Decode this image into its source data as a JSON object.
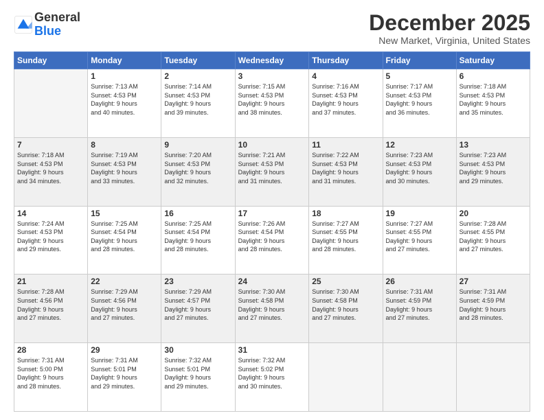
{
  "logo": {
    "general": "General",
    "blue": "Blue"
  },
  "title": "December 2025",
  "location": "New Market, Virginia, United States",
  "days_of_week": [
    "Sunday",
    "Monday",
    "Tuesday",
    "Wednesday",
    "Thursday",
    "Friday",
    "Saturday"
  ],
  "weeks": [
    [
      {
        "day": "",
        "info": ""
      },
      {
        "day": "1",
        "info": "Sunrise: 7:13 AM\nSunset: 4:53 PM\nDaylight: 9 hours\nand 40 minutes."
      },
      {
        "day": "2",
        "info": "Sunrise: 7:14 AM\nSunset: 4:53 PM\nDaylight: 9 hours\nand 39 minutes."
      },
      {
        "day": "3",
        "info": "Sunrise: 7:15 AM\nSunset: 4:53 PM\nDaylight: 9 hours\nand 38 minutes."
      },
      {
        "day": "4",
        "info": "Sunrise: 7:16 AM\nSunset: 4:53 PM\nDaylight: 9 hours\nand 37 minutes."
      },
      {
        "day": "5",
        "info": "Sunrise: 7:17 AM\nSunset: 4:53 PM\nDaylight: 9 hours\nand 36 minutes."
      },
      {
        "day": "6",
        "info": "Sunrise: 7:18 AM\nSunset: 4:53 PM\nDaylight: 9 hours\nand 35 minutes."
      }
    ],
    [
      {
        "day": "7",
        "info": "Sunrise: 7:18 AM\nSunset: 4:53 PM\nDaylight: 9 hours\nand 34 minutes."
      },
      {
        "day": "8",
        "info": "Sunrise: 7:19 AM\nSunset: 4:53 PM\nDaylight: 9 hours\nand 33 minutes."
      },
      {
        "day": "9",
        "info": "Sunrise: 7:20 AM\nSunset: 4:53 PM\nDaylight: 9 hours\nand 32 minutes."
      },
      {
        "day": "10",
        "info": "Sunrise: 7:21 AM\nSunset: 4:53 PM\nDaylight: 9 hours\nand 31 minutes."
      },
      {
        "day": "11",
        "info": "Sunrise: 7:22 AM\nSunset: 4:53 PM\nDaylight: 9 hours\nand 31 minutes."
      },
      {
        "day": "12",
        "info": "Sunrise: 7:23 AM\nSunset: 4:53 PM\nDaylight: 9 hours\nand 30 minutes."
      },
      {
        "day": "13",
        "info": "Sunrise: 7:23 AM\nSunset: 4:53 PM\nDaylight: 9 hours\nand 29 minutes."
      }
    ],
    [
      {
        "day": "14",
        "info": "Sunrise: 7:24 AM\nSunset: 4:53 PM\nDaylight: 9 hours\nand 29 minutes."
      },
      {
        "day": "15",
        "info": "Sunrise: 7:25 AM\nSunset: 4:54 PM\nDaylight: 9 hours\nand 28 minutes."
      },
      {
        "day": "16",
        "info": "Sunrise: 7:25 AM\nSunset: 4:54 PM\nDaylight: 9 hours\nand 28 minutes."
      },
      {
        "day": "17",
        "info": "Sunrise: 7:26 AM\nSunset: 4:54 PM\nDaylight: 9 hours\nand 28 minutes."
      },
      {
        "day": "18",
        "info": "Sunrise: 7:27 AM\nSunset: 4:55 PM\nDaylight: 9 hours\nand 28 minutes."
      },
      {
        "day": "19",
        "info": "Sunrise: 7:27 AM\nSunset: 4:55 PM\nDaylight: 9 hours\nand 27 minutes."
      },
      {
        "day": "20",
        "info": "Sunrise: 7:28 AM\nSunset: 4:55 PM\nDaylight: 9 hours\nand 27 minutes."
      }
    ],
    [
      {
        "day": "21",
        "info": "Sunrise: 7:28 AM\nSunset: 4:56 PM\nDaylight: 9 hours\nand 27 minutes."
      },
      {
        "day": "22",
        "info": "Sunrise: 7:29 AM\nSunset: 4:56 PM\nDaylight: 9 hours\nand 27 minutes."
      },
      {
        "day": "23",
        "info": "Sunrise: 7:29 AM\nSunset: 4:57 PM\nDaylight: 9 hours\nand 27 minutes."
      },
      {
        "day": "24",
        "info": "Sunrise: 7:30 AM\nSunset: 4:58 PM\nDaylight: 9 hours\nand 27 minutes."
      },
      {
        "day": "25",
        "info": "Sunrise: 7:30 AM\nSunset: 4:58 PM\nDaylight: 9 hours\nand 27 minutes."
      },
      {
        "day": "26",
        "info": "Sunrise: 7:31 AM\nSunset: 4:59 PM\nDaylight: 9 hours\nand 27 minutes."
      },
      {
        "day": "27",
        "info": "Sunrise: 7:31 AM\nSunset: 4:59 PM\nDaylight: 9 hours\nand 28 minutes."
      }
    ],
    [
      {
        "day": "28",
        "info": "Sunrise: 7:31 AM\nSunset: 5:00 PM\nDaylight: 9 hours\nand 28 minutes."
      },
      {
        "day": "29",
        "info": "Sunrise: 7:31 AM\nSunset: 5:01 PM\nDaylight: 9 hours\nand 29 minutes."
      },
      {
        "day": "30",
        "info": "Sunrise: 7:32 AM\nSunset: 5:01 PM\nDaylight: 9 hours\nand 29 minutes."
      },
      {
        "day": "31",
        "info": "Sunrise: 7:32 AM\nSunset: 5:02 PM\nDaylight: 9 hours\nand 30 minutes."
      },
      {
        "day": "",
        "info": ""
      },
      {
        "day": "",
        "info": ""
      },
      {
        "day": "",
        "info": ""
      }
    ]
  ]
}
